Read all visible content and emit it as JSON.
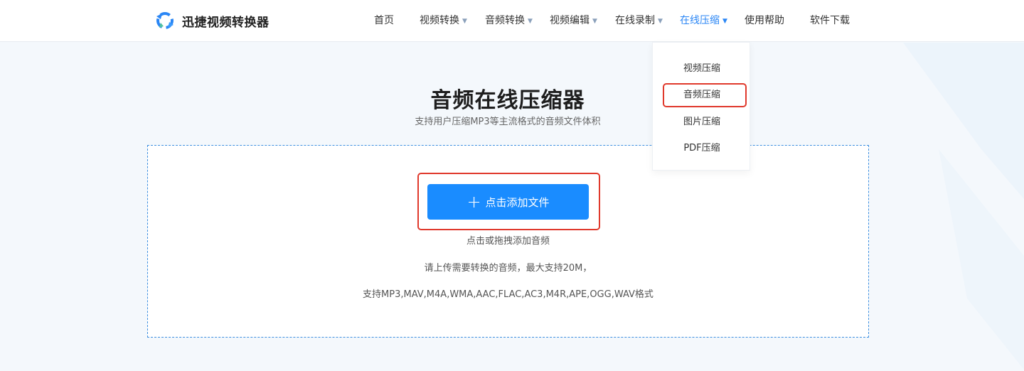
{
  "header": {
    "brand": "迅捷视频转换器",
    "nav": [
      {
        "label": "首页",
        "has_caret": false
      },
      {
        "label": "视频转换",
        "has_caret": true
      },
      {
        "label": "音频转换",
        "has_caret": true
      },
      {
        "label": "视频编辑",
        "has_caret": true
      },
      {
        "label": "在线录制",
        "has_caret": true
      },
      {
        "label": "在线压缩",
        "has_caret": true,
        "active": true
      },
      {
        "label": "使用帮助",
        "has_caret": false
      },
      {
        "label": "软件下载",
        "has_caret": false
      }
    ],
    "caret_glyph": "▼"
  },
  "dropdown": {
    "items": [
      "视频压缩",
      "音频压缩",
      "图片压缩",
      "PDF压缩"
    ],
    "highlighted": "音频压缩"
  },
  "main": {
    "title": "音频在线压缩器",
    "subtitle": "支持用户压缩MP3等主流格式的音频文件体积",
    "add_button": {
      "icon": "plus-icon",
      "plus": "+",
      "label": "点击添加文件"
    },
    "drag_hint": "点击或拖拽添加音频",
    "size_hint": "请上传需要转换的音频，最大支持20M，",
    "format_hint": "支持MP3,MAV,M4A,WMA,AAC,FLAC,AC3,M4R,APE,OGG,WAV格式"
  },
  "colors": {
    "accent": "#1a8cff",
    "active_nav": "#2a86f5",
    "highlight_border": "#e0392c",
    "page_bg": "#f4f8fc"
  }
}
